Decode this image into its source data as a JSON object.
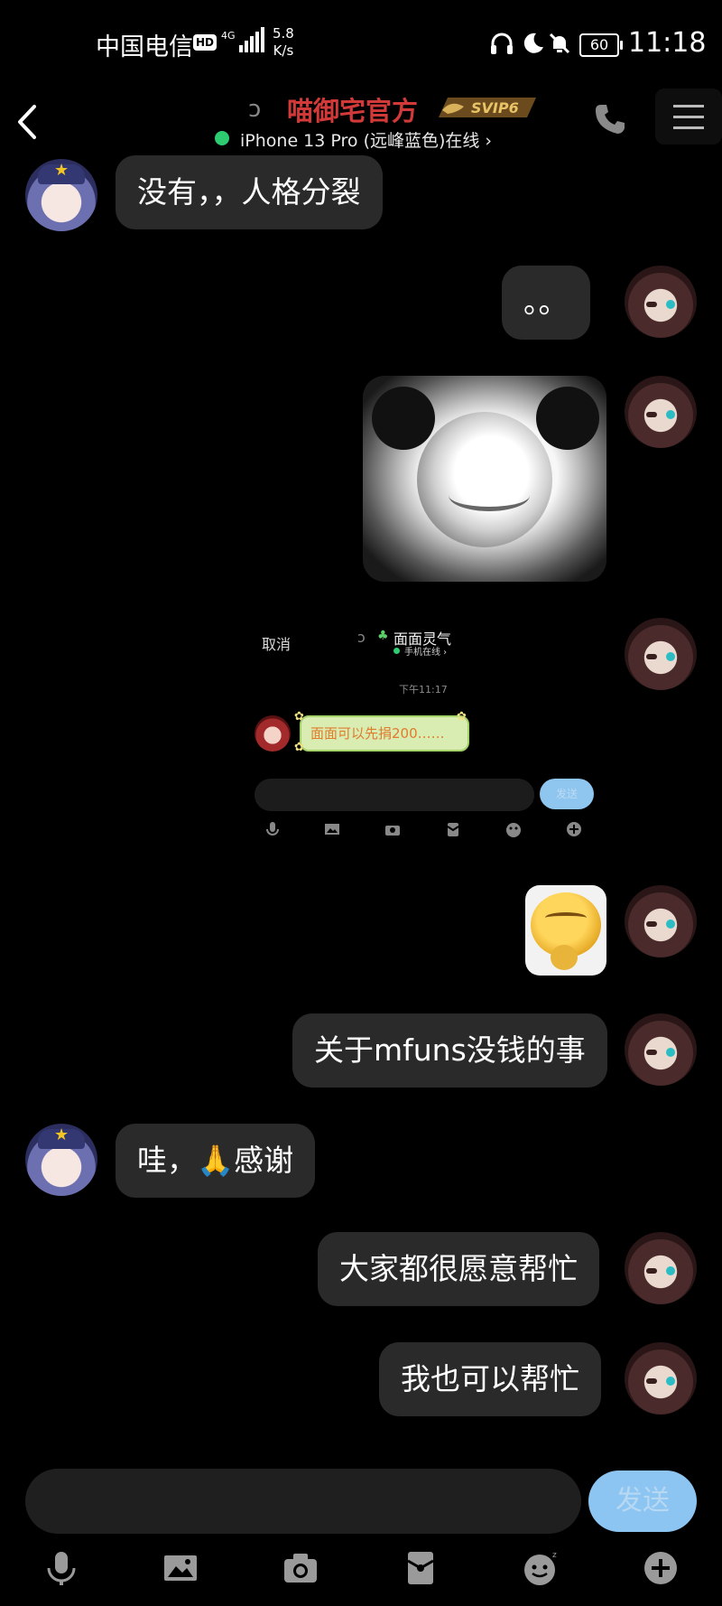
{
  "status_bar": {
    "carrier": "中国电信",
    "hd": "HD",
    "network": "4G",
    "speed_value": "5.8",
    "speed_unit": "K/s",
    "battery": "60",
    "time": "11:18"
  },
  "header": {
    "title": "喵御宅官方",
    "badge": "SVIP6",
    "device_status": "iPhone 13 Pro (远峰蓝色)在线 ›"
  },
  "messages": [
    {
      "side": "left",
      "text": "没有，，人格分裂"
    },
    {
      "side": "right",
      "text": "。。"
    },
    {
      "side": "right",
      "type": "sticker",
      "sticker": "panda-meme"
    },
    {
      "side": "right",
      "type": "screenshot"
    },
    {
      "side": "right",
      "type": "sticker",
      "sticker": "yellow-blob"
    },
    {
      "side": "right",
      "text": "关于mfuns没钱的事"
    },
    {
      "side": "left",
      "text": "哇，🙏感谢"
    },
    {
      "side": "right",
      "text": "大家都很愿意帮忙"
    },
    {
      "side": "right",
      "text": "我也可以帮忙"
    }
  ],
  "embedded_screenshot": {
    "cancel": "取消",
    "contact_name": "面面灵气",
    "contact_status": "手机在线 ›",
    "timestamp": "下午11:17",
    "message": "面面可以先捐200……",
    "send_label": "发送"
  },
  "composer": {
    "send_label": "发送",
    "tools": [
      "mic-icon",
      "image-icon",
      "camera-icon",
      "red-packet-icon",
      "emoji-icon",
      "plus-icon"
    ]
  },
  "colors": {
    "background": "#000000",
    "bubble": "#2a2a2a",
    "title": "#d23a3a",
    "online": "#2ecc71",
    "send_button": "#8cc4f2"
  }
}
